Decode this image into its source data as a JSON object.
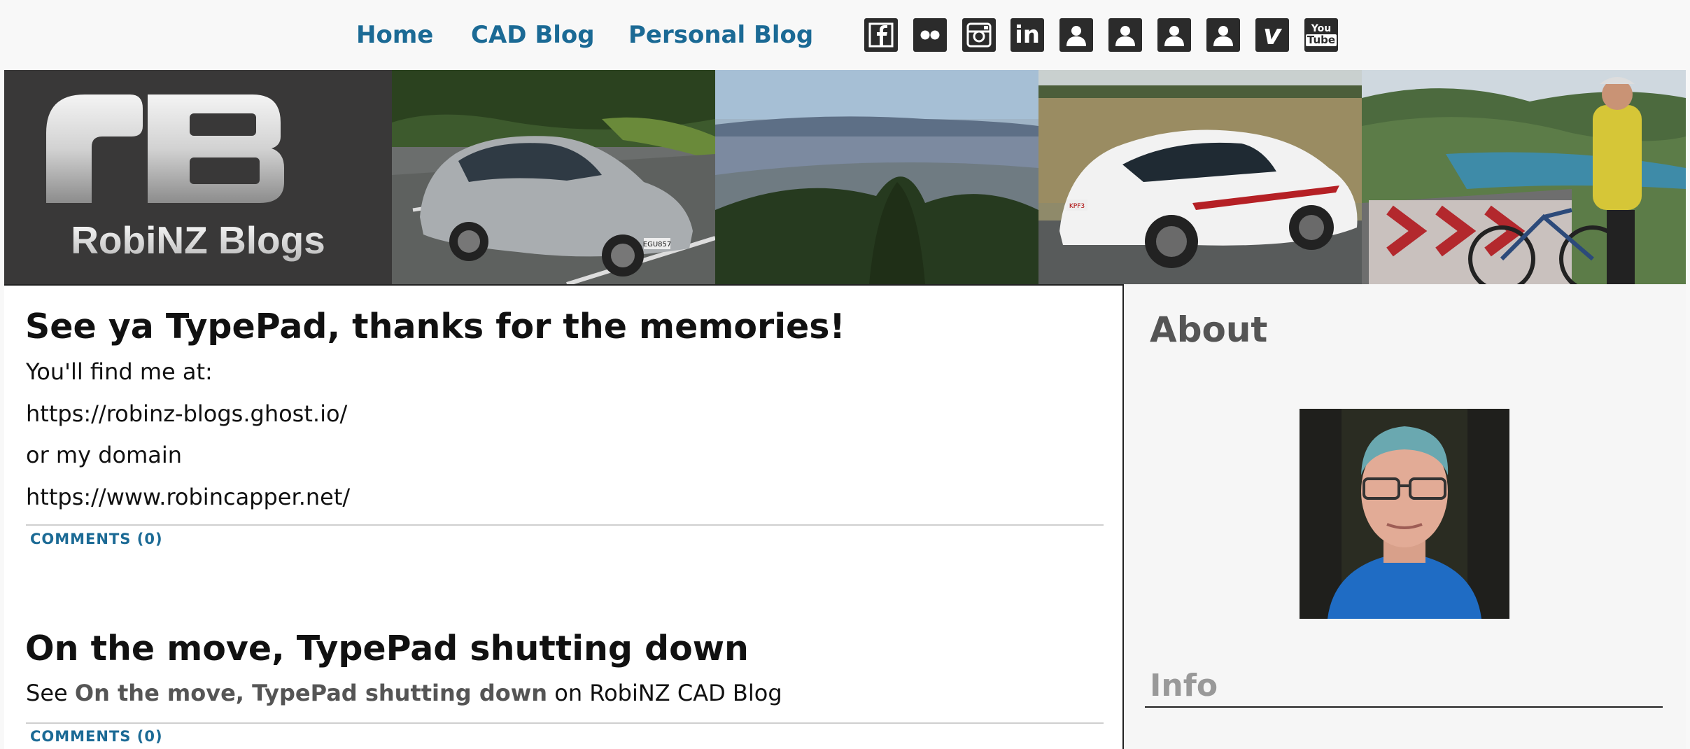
{
  "nav": {
    "links": [
      "Home",
      "CAD Blog",
      "Personal Blog"
    ],
    "social_icons": [
      "facebook-icon",
      "flickr-icon",
      "instagram-icon",
      "linkedin-icon",
      "profile-icon",
      "profile-icon",
      "profile-icon",
      "profile-icon",
      "vimeo-icon",
      "youtube-icon"
    ],
    "youtube_text_top": "You",
    "youtube_text_bottom": "Tube",
    "vimeo_text": "v",
    "linkedin_text": "in"
  },
  "banner": {
    "logo_letters": "rB",
    "logo_text": "RobiNZ Blogs",
    "car_plate": "EGU857",
    "car2_plate": "KPF3"
  },
  "posts": [
    {
      "title": "See ya TypePad, thanks for the memories!",
      "paragraphs": [
        "You'll find me at:",
        "https://robinz-blogs.ghost.io/",
        "or my domain",
        "https://www.robincapper.net/"
      ],
      "comments": "COMMENTS (0)"
    },
    {
      "title": "On the move, TypePad shutting down",
      "text_before": "See ",
      "link_text": "On the move, TypePad shutting down",
      "text_after": " on RobiNZ CAD Blog",
      "comments": "COMMENTS (0)"
    }
  ],
  "sidebar": {
    "about_heading": "About",
    "info_heading": "Info"
  },
  "colors": {
    "link": "#1b6a95",
    "icon_bg": "#2b2b2b",
    "banner_bg": "#393838",
    "heading_gray": "#555555"
  }
}
